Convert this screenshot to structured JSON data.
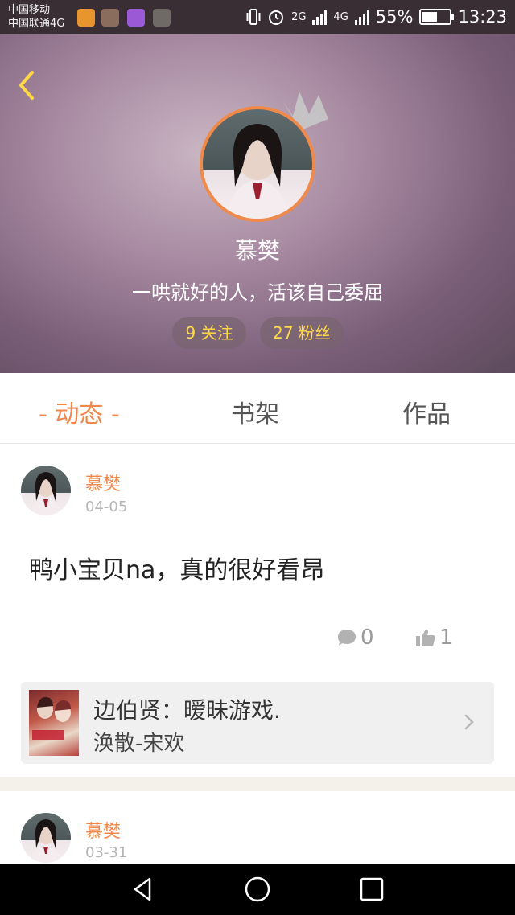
{
  "status_bar": {
    "carrier_1": "中国移动",
    "carrier_2": "中国联通4G",
    "net_1": "2G",
    "net_2": "4G",
    "battery_percent": "55%",
    "battery_level": 0.55,
    "time": "13:23"
  },
  "profile": {
    "name": "慕樊",
    "bio": "一哄就好的人，活该自己委屈",
    "following": "9 关注",
    "followers": "27 粉丝"
  },
  "tabs": {
    "active": "- 动态 -",
    "shelf": "书架",
    "works": "作品"
  },
  "posts": [
    {
      "author": "慕樊",
      "date": "04-05",
      "text": "鸭小宝贝na，真的很好看昂",
      "comments": "0",
      "likes": "1",
      "book": {
        "title": "边伯贤：暧昧游戏.",
        "author": "涣散-宋欢"
      }
    },
    {
      "author": "慕樊",
      "date": "03-31"
    }
  ],
  "colors": {
    "accent": "#f0884b",
    "follow_text": "#ffd84a",
    "status_bar": "#3a2e35"
  },
  "icons": {
    "back": "chevron-left-icon",
    "crown": "crown-icon",
    "comment": "comment-bubble-icon",
    "like": "thumbs-up-icon",
    "book_link": "chevron-right-icon"
  }
}
